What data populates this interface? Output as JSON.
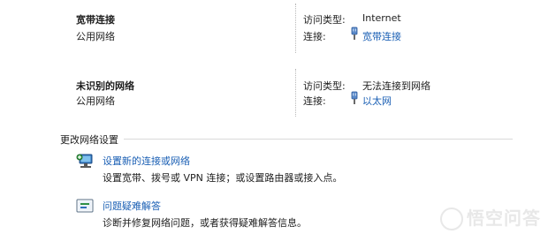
{
  "networks": [
    {
      "name": "宽带连接",
      "category": "公用网络",
      "access_type_label": "访问类型:",
      "access_type_value": "Internet",
      "connection_label": "连接:",
      "connection_value": "宽带连接"
    },
    {
      "name": "未识别的网络",
      "category": "公用网络",
      "access_type_label": "访问类型:",
      "access_type_value": "无法连接到网络",
      "connection_label": "连接:",
      "connection_value": "以太网"
    }
  ],
  "change_settings": {
    "header": "更改网络设置",
    "items": [
      {
        "icon": "network-setup-icon",
        "title": "设置新的连接或网络",
        "desc": "设置宽带、拨号或 VPN 连接；或设置路由器或接入点。"
      },
      {
        "icon": "troubleshoot-icon",
        "title": "问题疑难解答",
        "desc": "诊断并修复网络问题，或者获得疑难解答信息。"
      }
    ]
  },
  "watermark": "悟空问答"
}
